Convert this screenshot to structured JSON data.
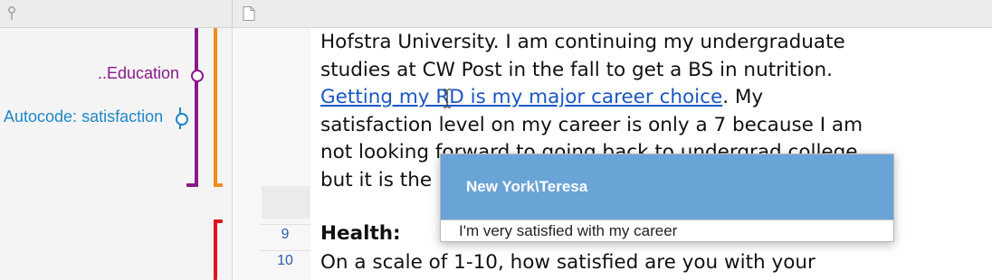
{
  "toolbar": {
    "left_icon": "pin-icon",
    "doc_icon": "document-icon"
  },
  "codes": {
    "education_label": "..Education",
    "autocode_label": "Autocode: satisfaction",
    "colors": {
      "education": "#8b1a8b",
      "autocode": "#1e88c8",
      "orange": "#f08c1e",
      "red": "#e0141e"
    }
  },
  "document": {
    "lines": [
      "Hofstra University.  I am continuing my undergraduate",
      "studies at CW Post in the fall to get a BS in nutrition.",
      "satisfaction level on my career is only a 7 because I am",
      "not looking forward to going back to undergrad college",
      "but it is the"
    ],
    "link_text": "Getting my RD is my major career choice",
    "after_link": ".  My",
    "line_numbers": [
      "9",
      "10"
    ],
    "heading": "Health:",
    "question": "On a scale of 1-10, how satisfied are you with your"
  },
  "popup": {
    "title": "New York\\Teresa",
    "quote": "I'm very satisfied with my career"
  }
}
